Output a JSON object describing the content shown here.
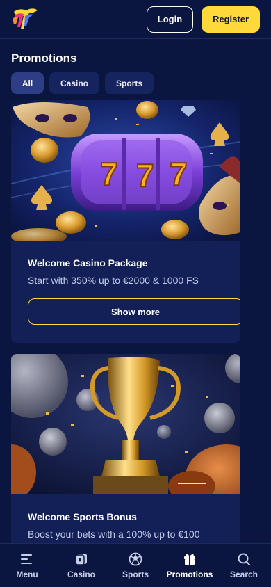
{
  "header": {
    "login_label": "Login",
    "register_label": "Register"
  },
  "page": {
    "title": "Promotions"
  },
  "tabs": [
    {
      "label": "All",
      "active": true
    },
    {
      "label": "Casino",
      "active": false
    },
    {
      "label": "Sports",
      "active": false
    }
  ],
  "promotions": [
    {
      "title": "Welcome Casino Package",
      "description": "Start with 350% up to €2000 & 1000 FS",
      "button_label": "Show more"
    },
    {
      "title": "Welcome Sports Bonus",
      "description": "Boost your bets with a 100% up to €100"
    }
  ],
  "bottom_nav": [
    {
      "label": "Menu",
      "icon": "menu-icon"
    },
    {
      "label": "Casino",
      "icon": "casino-icon"
    },
    {
      "label": "Sports",
      "icon": "soccer-ball-icon"
    },
    {
      "label": "Promotions",
      "icon": "gift-icon",
      "active": true
    },
    {
      "label": "Search",
      "icon": "search-icon"
    }
  ],
  "colors": {
    "background": "#0b1640",
    "card": "#122057",
    "accent": "#ffd93a",
    "tab": "#15245e",
    "tab_active": "#2e3e86"
  }
}
